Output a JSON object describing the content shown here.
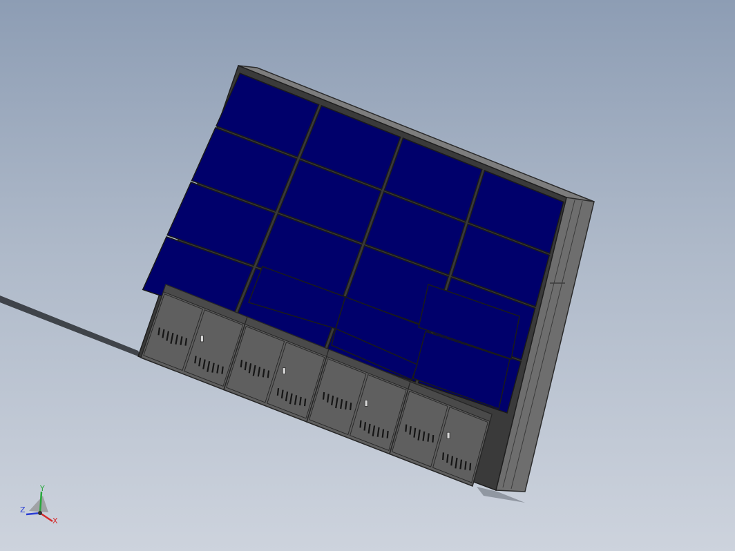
{
  "viewport": {
    "background_top": "#8d9db4",
    "background_bottom": "#cdd3dd"
  },
  "model": {
    "name": "video-wall-cabinet",
    "screen_grid": {
      "rows": 4,
      "cols": 4
    },
    "cabinet_count": 4,
    "colors": {
      "screen": "#00006b",
      "seam": "#1a1a1a",
      "frame": "#3a3a3a",
      "cabinet": "#5f5f5f",
      "cabinet_dark": "#4a4a4a",
      "side_panel": "#6e6e6e",
      "top": "#7d7d7d"
    }
  },
  "triad": {
    "x_label": "X",
    "y_label": "Y",
    "z_label": "Z",
    "x_color": "#d42a2a",
    "y_color": "#27a83b",
    "z_color": "#2a3dd4"
  }
}
